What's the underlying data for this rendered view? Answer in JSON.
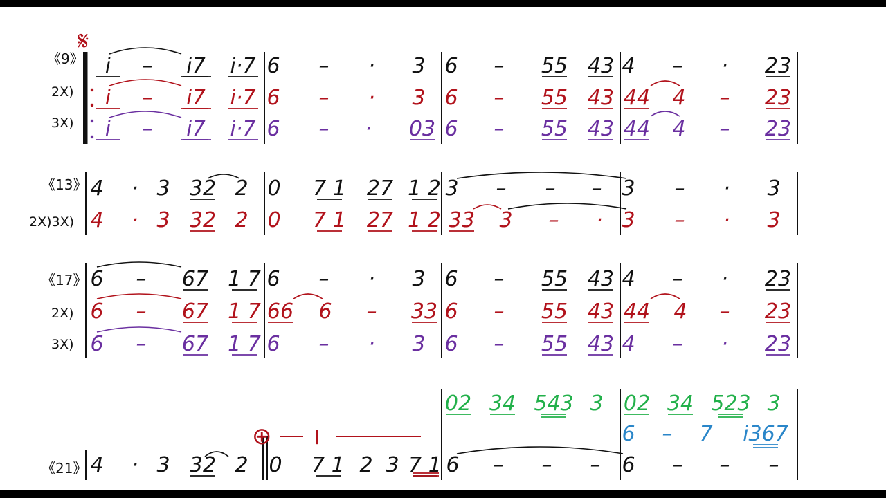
{
  "colors": {
    "black": "#111111",
    "red": "#b1121b",
    "purple": "#6a2fa0",
    "green": "#22b04a",
    "blue": "#2a86c9"
  },
  "systems": [
    {
      "id": "sys9",
      "label": "《9》",
      "rows": [
        {
          "label": "",
          "color": "black",
          "tokens": [
            "i̇",
            "–",
            "i̇7",
            "i̇·7",
            "6",
            "–",
            "·",
            "3",
            "6",
            "–",
            "55",
            "43",
            "4",
            "–",
            "·",
            "23"
          ]
        },
        {
          "label": "2X)",
          "color": "red",
          "tokens": [
            "i̇",
            "–",
            "i̇7",
            "i̇·7",
            "6",
            "–",
            "·",
            "3",
            "6",
            "–",
            "55",
            "43",
            "44",
            "4",
            "–",
            "23"
          ]
        },
        {
          "label": "3X)",
          "color": "purple",
          "tokens": [
            "i̇",
            "–",
            "i̇7",
            "i̇·7",
            "6",
            "–",
            "·",
            "03",
            "6",
            "–",
            "55",
            "43",
            "44",
            "4",
            "–",
            "23"
          ]
        }
      ]
    },
    {
      "id": "sys13",
      "label": "《13》",
      "rows": [
        {
          "label": "",
          "color": "black",
          "tokens": [
            "4",
            "·",
            "3",
            "32",
            "2",
            "0",
            "7 1",
            "27",
            "1 2",
            "3",
            "–",
            "–",
            "–",
            "3",
            "–",
            "·",
            "3"
          ]
        },
        {
          "label": "2X)3X)",
          "color": "red",
          "tokens": [
            "4",
            "·",
            "3",
            "32",
            "2",
            "0",
            "7 1",
            "27",
            "1 2",
            "33",
            "3",
            "–",
            "·",
            "3",
            "–",
            "·",
            "3"
          ]
        }
      ]
    },
    {
      "id": "sys17",
      "label": "《17》",
      "rows": [
        {
          "label": "",
          "color": "black",
          "tokens": [
            "6",
            "–",
            "67",
            "1 7",
            "6",
            "–",
            "·",
            "3",
            "6",
            "–",
            "55",
            "43",
            "4",
            "–",
            "·",
            "23"
          ]
        },
        {
          "label": "2X)",
          "color": "red",
          "tokens": [
            "6",
            "–",
            "67",
            "1 7",
            "66",
            "6",
            "–",
            "33",
            "6",
            "–",
            "55",
            "43",
            "44",
            "4",
            "–",
            "23"
          ]
        },
        {
          "label": "3X)",
          "color": "purple",
          "tokens": [
            "6",
            "–",
            "67",
            "1 7",
            "6",
            "–",
            "·",
            "3",
            "6",
            "–",
            "55",
            "43",
            "4",
            "–",
            "·",
            "23"
          ]
        }
      ]
    },
    {
      "id": "sys21",
      "label": "《21》",
      "rows": [
        {
          "label": "",
          "color": "green",
          "tokens": [
            "02",
            "34",
            "543",
            "3",
            "02",
            "34",
            "523",
            "3"
          ]
        },
        {
          "label": "",
          "color": "blue",
          "tokens": [
            "6",
            "–",
            "7",
            "i̇367"
          ]
        },
        {
          "label": "",
          "color": "black",
          "tokens": [
            "4",
            "·",
            "3",
            "32",
            "2",
            "0",
            "7 1",
            "2",
            "3",
            "7 1",
            "6",
            "–",
            "–",
            "–",
            "6",
            "–",
            "–",
            "–"
          ]
        }
      ]
    }
  ],
  "marks": {
    "segno": "𝄋",
    "coda": "⊕",
    "roman_one": "I"
  }
}
